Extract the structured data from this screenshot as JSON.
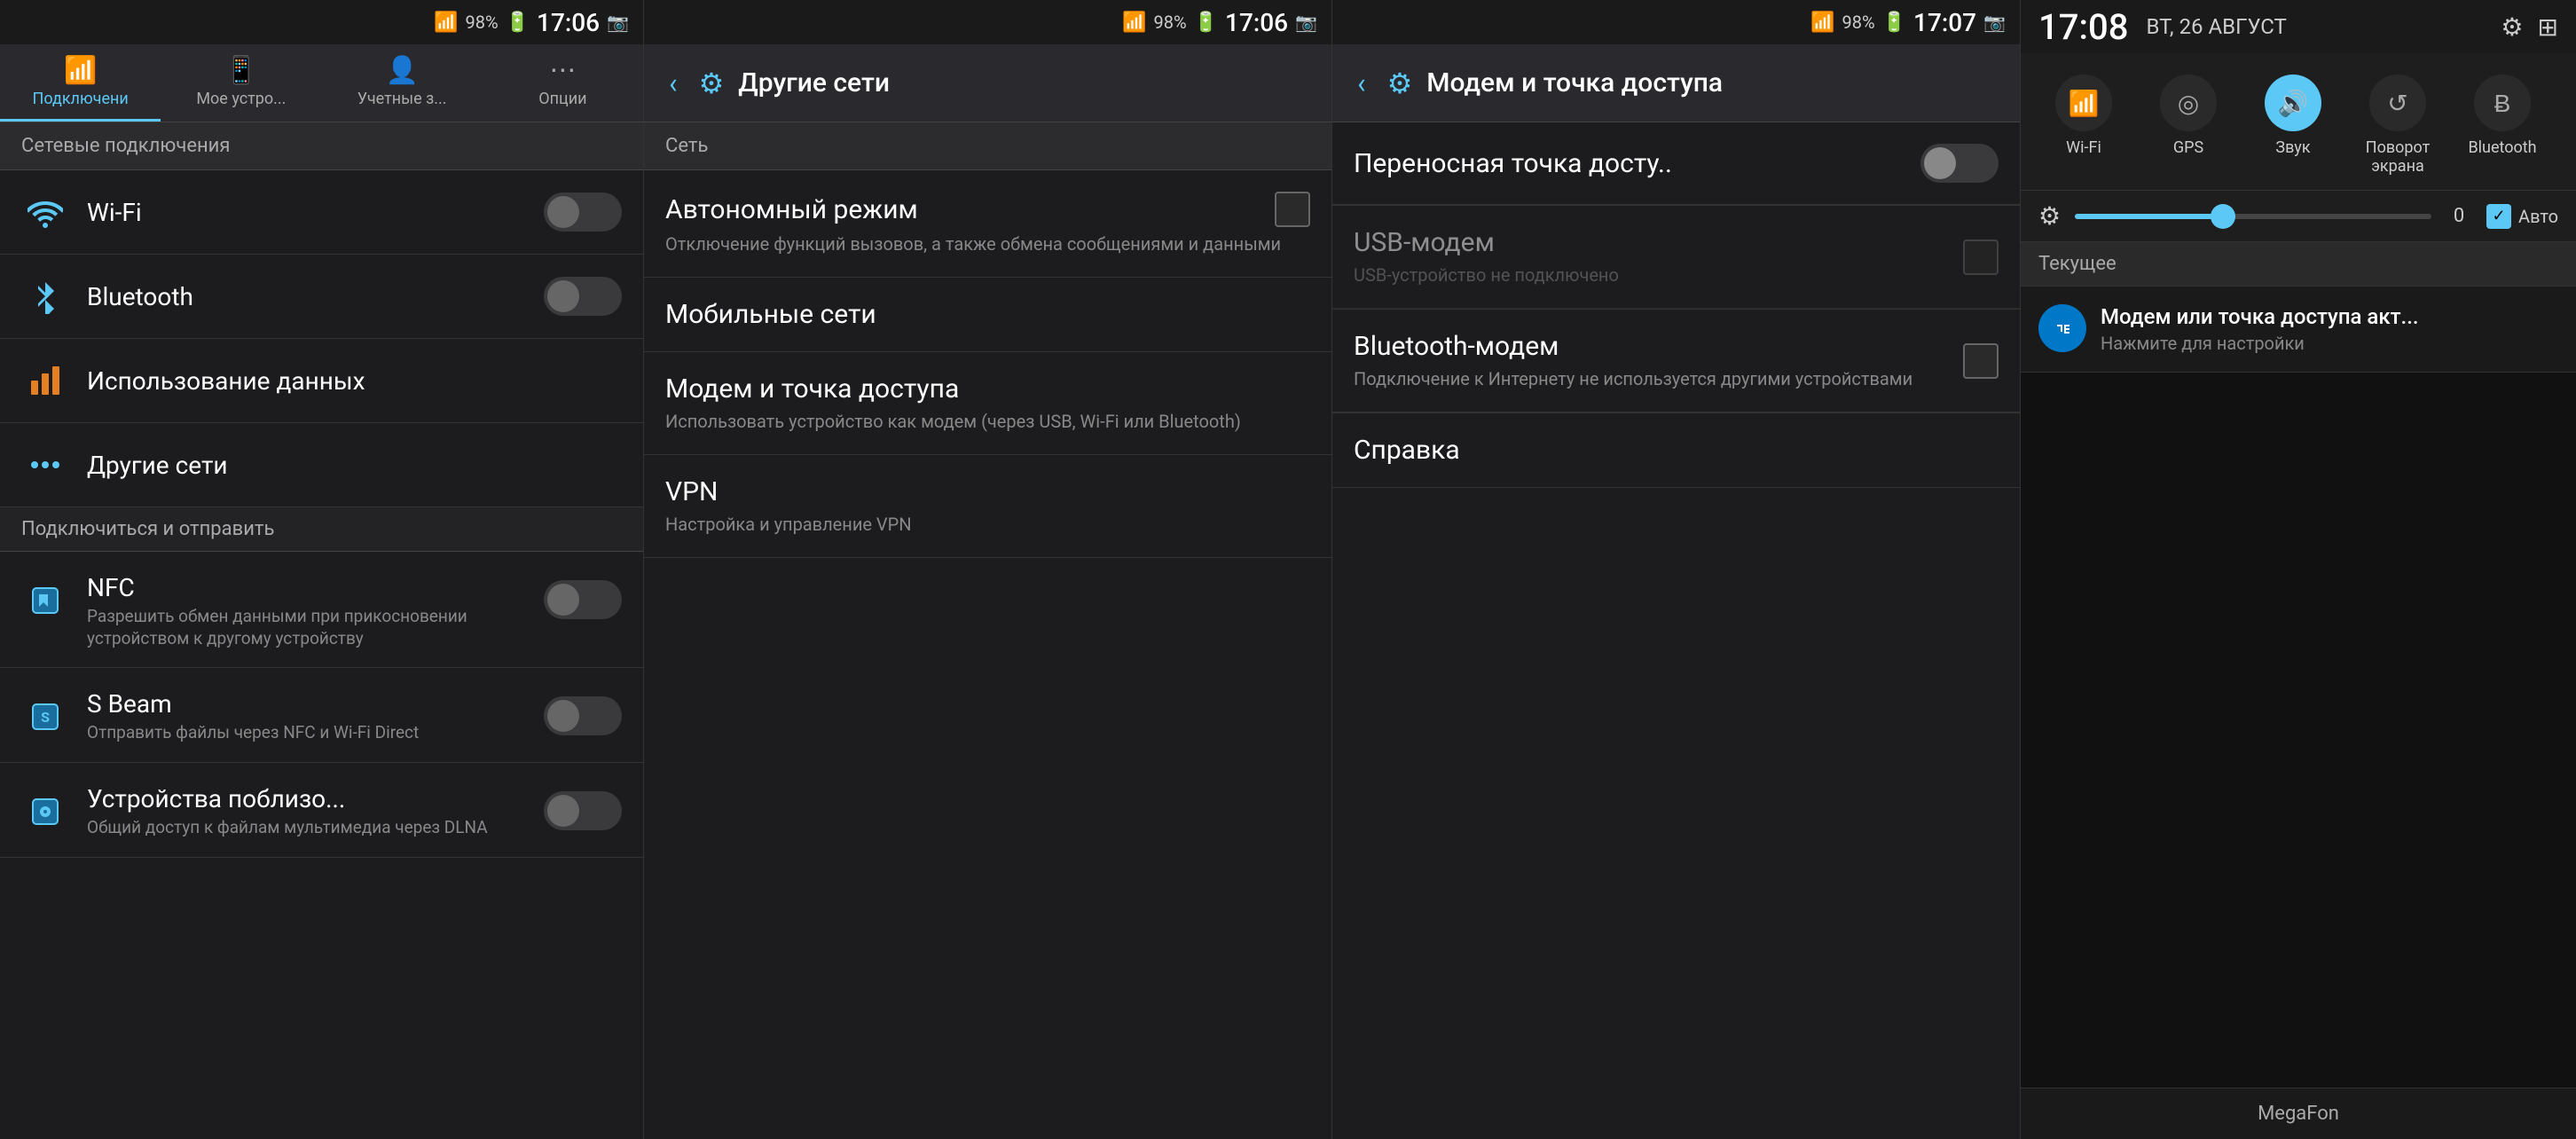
{
  "panel1": {
    "status": {
      "battery": "98%",
      "time": "17:06"
    },
    "tabs": [
      {
        "id": "connections",
        "label": "Подключени",
        "icon": "📶",
        "active": true
      },
      {
        "id": "device",
        "label": "Мое устро...",
        "icon": "📱",
        "active": false
      },
      {
        "id": "accounts",
        "label": "Учетные з...",
        "icon": "👤",
        "active": false
      },
      {
        "id": "options",
        "label": "Опции",
        "icon": "⋯",
        "active": false
      }
    ],
    "network_section": "Сетевые подключения",
    "wifi": {
      "title": "Wi-Fi",
      "toggle": "off"
    },
    "bluetooth": {
      "title": "Bluetooth",
      "toggle": "off"
    },
    "data_usage": {
      "title": "Использование данных"
    },
    "other_networks": {
      "title": "Другие сети"
    },
    "connect_section": "Подключиться и отправить",
    "nfc": {
      "title": "NFC",
      "desc": "Разрешить обмен данными при прикосновении устройством к другому устройству",
      "toggle": "off"
    },
    "sbeam": {
      "title": "S Beam",
      "desc": "Отправить файлы через NFC и Wi-Fi Direct",
      "toggle": "off"
    },
    "nearby": {
      "title": "Устройства поблизо...",
      "desc": "Общий доступ к файлам мультимедиа через DLNA",
      "toggle": "off"
    }
  },
  "panel2": {
    "status": {
      "battery": "98%",
      "time": "17:06"
    },
    "header": {
      "title": "Другие сети"
    },
    "section": "Сеть",
    "items": [
      {
        "title": "Автономный режим",
        "desc": "Отключение функций вызовов, а также обмена сообщениями и данными",
        "has_checkbox": true
      },
      {
        "title": "Мобильные сети",
        "desc": "",
        "has_checkbox": false
      },
      {
        "title": "Модем и точка доступа",
        "desc": "Использовать устройство как модем (через USB, Wi-Fi или Bluetooth)",
        "has_checkbox": false
      },
      {
        "title": "VPN",
        "desc": "Настройка и управление VPN",
        "has_checkbox": false
      }
    ]
  },
  "panel3": {
    "status": {
      "battery": "98%",
      "time": "17:07"
    },
    "header": {
      "title": "Модем и точка доступа"
    },
    "items": [
      {
        "title": "Переносная точка досту..",
        "desc": "",
        "has_toggle": true,
        "toggle_on": false
      },
      {
        "title": "USB-модем",
        "desc": "USB-устройство не подключено",
        "has_toggle": false,
        "has_checkbox": true,
        "disabled": true
      },
      {
        "title": "Bluetooth-модем",
        "desc": "Подключение к Интернету не используется другими устройствами",
        "has_toggle": false,
        "has_checkbox": true
      },
      {
        "title": "Справка",
        "desc": "",
        "has_toggle": false,
        "has_checkbox": false
      }
    ]
  },
  "panel4": {
    "time": "17:08",
    "date": "ВТ, 26 АВГУСТ",
    "quick_toggles": [
      {
        "id": "wifi",
        "label": "Wi-Fi",
        "icon": "📶",
        "active": false
      },
      {
        "id": "gps",
        "label": "GPS",
        "icon": "◎",
        "active": false
      },
      {
        "id": "sound",
        "label": "Звук",
        "icon": "🔊",
        "active": true
      },
      {
        "id": "rotate",
        "label": "Поворот экрана",
        "icon": "↺",
        "active": false
      },
      {
        "id": "bluetooth",
        "label": "Bluetooth",
        "icon": "Ƀ",
        "active": false
      }
    ],
    "brightness": {
      "value": "0",
      "auto": "Авто"
    },
    "section_title": "Текущее",
    "notification": {
      "title": "Модем или точка доступа акт...",
      "desc": "Нажмите для настройки"
    },
    "carrier": "MegaFon"
  }
}
